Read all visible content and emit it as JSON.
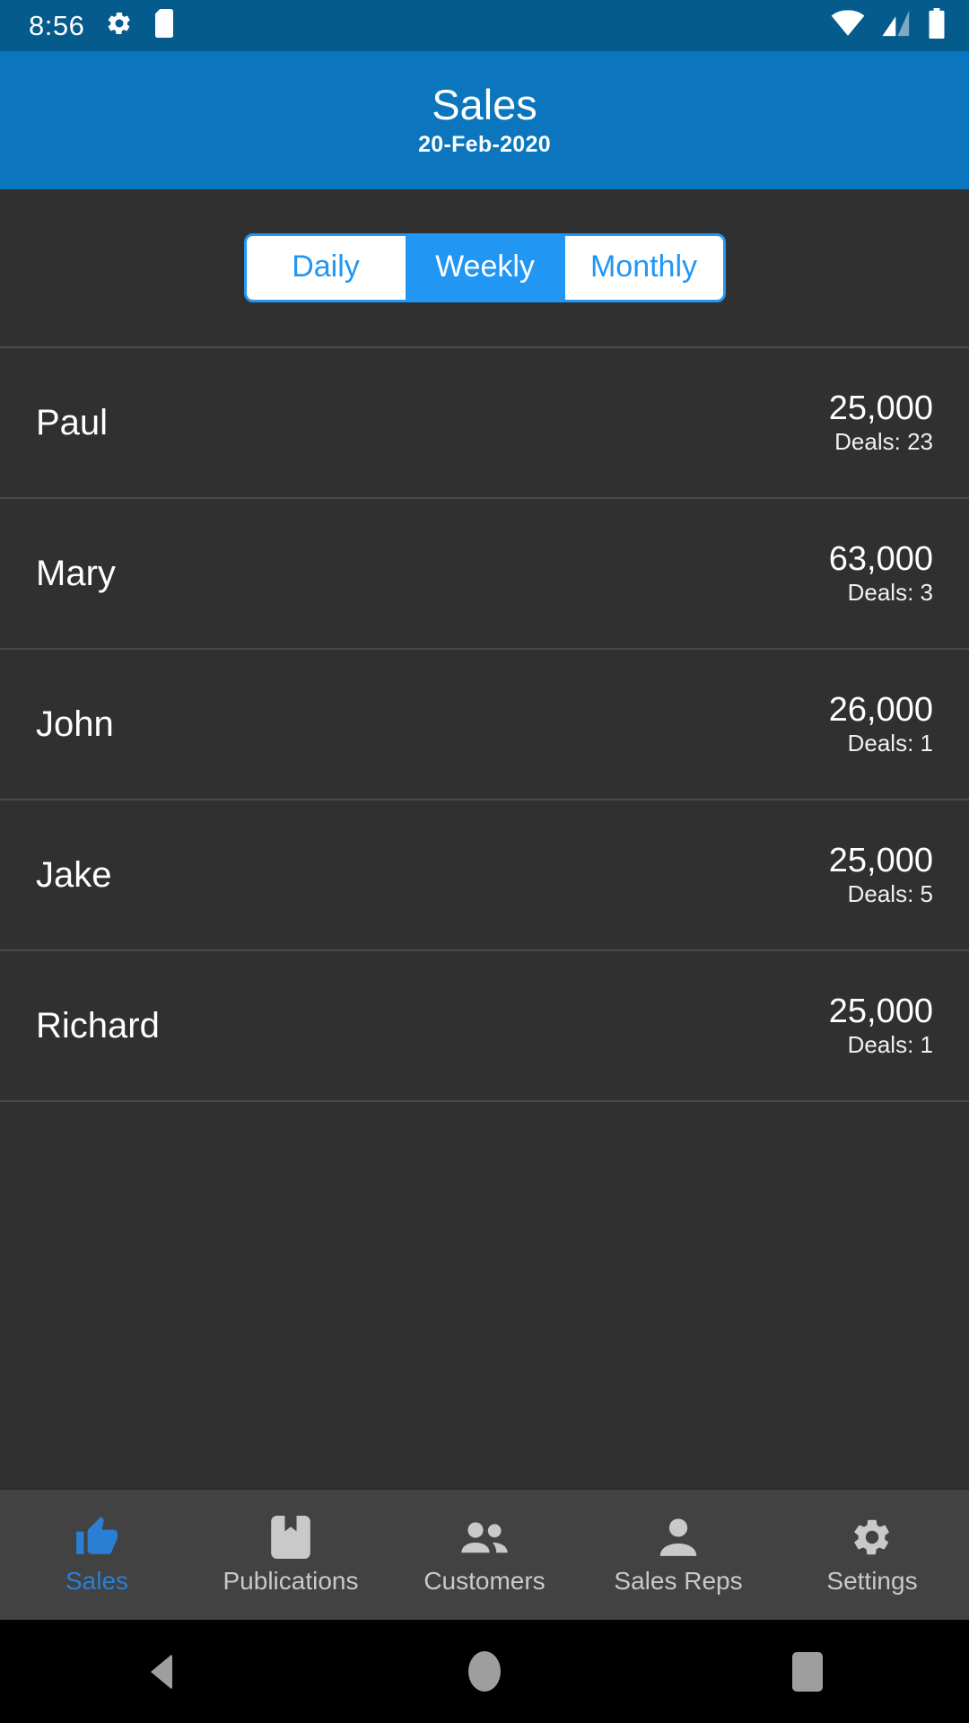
{
  "status_bar": {
    "time": "8:56",
    "icons": [
      "gear-icon",
      "sd-card-icon",
      "wifi-icon",
      "cellular-signal-icon",
      "battery-icon"
    ],
    "background_color": "#055b8c"
  },
  "app_bar": {
    "title": "Sales",
    "subtitle": "20-Feb-2020",
    "background_color": "#0b76bd"
  },
  "segmented_control": {
    "accent_color": "#2196f3",
    "selected": "Weekly",
    "options": [
      {
        "label": "Daily",
        "selected": false
      },
      {
        "label": "Weekly",
        "selected": true
      },
      {
        "label": "Monthly",
        "selected": false
      }
    ]
  },
  "list": {
    "deals_prefix": "Deals: ",
    "rows": [
      {
        "name": "Paul",
        "amount": "25,000",
        "deals": "Deals: 23"
      },
      {
        "name": "Mary",
        "amount": "63,000",
        "deals": "Deals: 3"
      },
      {
        "name": "John",
        "amount": "26,000",
        "deals": "Deals: 1"
      },
      {
        "name": "Jake",
        "amount": "25,000",
        "deals": "Deals: 5"
      },
      {
        "name": "Richard",
        "amount": "25,000",
        "deals": "Deals: 1"
      }
    ]
  },
  "bottom_nav": {
    "active_color": "#2a7fd4",
    "inactive_color": "#c9c9c9",
    "items": [
      {
        "label": "Sales",
        "icon": "thumbs-up-icon",
        "active": true
      },
      {
        "label": "Publications",
        "icon": "bookmark-icon",
        "active": false
      },
      {
        "label": "Customers",
        "icon": "people-icon",
        "active": false
      },
      {
        "label": "Sales Reps",
        "icon": "person-icon",
        "active": false
      },
      {
        "label": "Settings",
        "icon": "gear-icon",
        "active": false
      }
    ]
  },
  "system_nav": {
    "buttons": [
      {
        "name": "back-button",
        "icon": "triangle-back-icon"
      },
      {
        "name": "home-button",
        "icon": "circle-home-icon"
      },
      {
        "name": "recents-button",
        "icon": "square-recents-icon"
      }
    ]
  }
}
